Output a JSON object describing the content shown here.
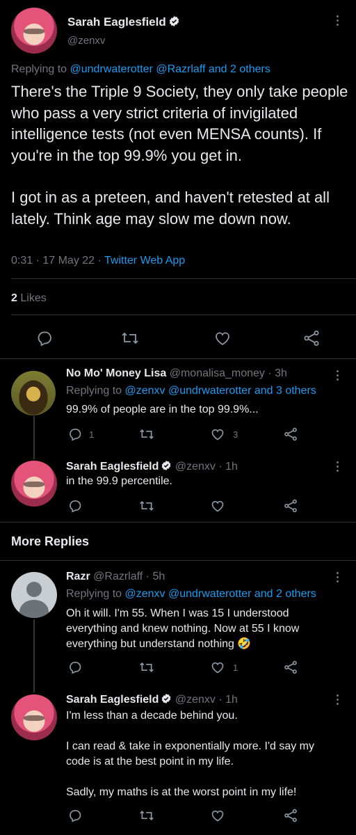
{
  "main_tweet": {
    "author_name": "Sarah Eaglesfield",
    "handle": "@zenxv",
    "replying_prefix": "Replying to",
    "replying_to": "@undrwaterotter @Razrlaff and 2 others",
    "text_p1": "There's the Triple 9 Society, they only take people who pass a very strict criteria  of invigilated intelligence tests (not even MENSA counts). If you're in the top 99.9% you get in.",
    "text_p2": "I got in as a preteen, and haven't retested at all lately. Think age may slow me down now.",
    "timestamp": "0:31 · 17 May 22 · ",
    "source": "Twitter Web App",
    "likes_count": "2",
    "likes_label": "Likes"
  },
  "replies": [
    {
      "author_name": "No Mo' Money Lisa",
      "handle_time": "@monalisa_money · 3h",
      "replying_prefix": "Replying to",
      "replying_to": "@zenxv @undrwaterotter and 3 others",
      "text": "99.9% of people are in the top 99.9%...",
      "reply_count": "1",
      "like_count": "3"
    },
    {
      "author_name": "Sarah Eaglesfield",
      "handle_time": "@zenxv · 1h",
      "text": "in the 99.9 percentile."
    }
  ],
  "more_replies": {
    "heading": "More Replies",
    "items": [
      {
        "author_name": "Razr",
        "handle_time": "@Razrlaff · 5h",
        "replying_prefix": "Replying to",
        "replying_to": "@zenxv @undrwaterotter and 2 others",
        "text": "Oh it will. I'm 55. When I was 15 I understood everything and knew nothing. Now at 55 I know everything but understand nothing 🤣",
        "like_count": "1"
      },
      {
        "author_name": "Sarah Eaglesfield",
        "handle_time": "@zenxv · 1h",
        "text_p1": "I'm less than a decade behind you.",
        "text_p2": "I can read & take in exponentially more. I'd say my code is at the best point in my life.",
        "text_p3": "Sadly, my maths is at the worst point in my life!"
      }
    ]
  },
  "colors": {
    "background": "#000000",
    "text": "#e7e9ea",
    "muted": "#71767b",
    "accent": "#1d9bf0",
    "divider": "#2f3336"
  }
}
